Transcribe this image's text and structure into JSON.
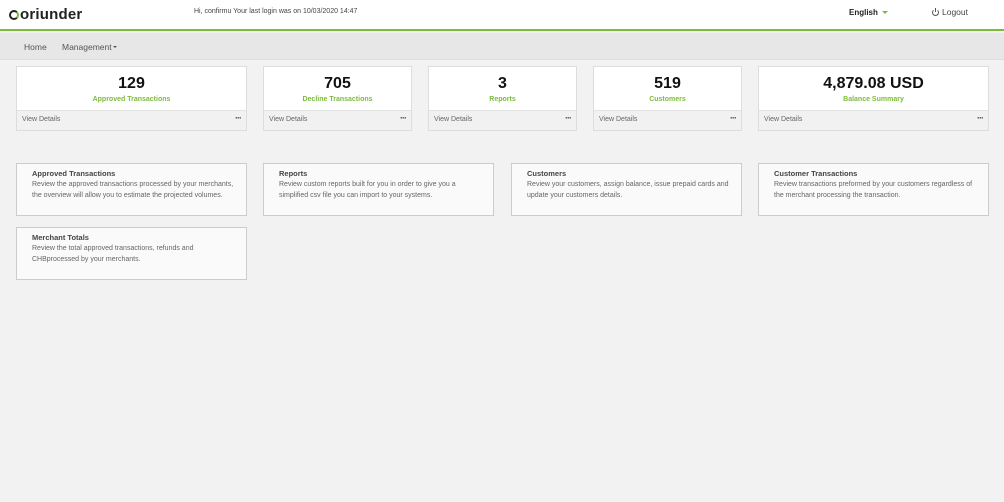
{
  "header": {
    "logo_text": "oriunder",
    "greeting": "Hi, confirmu Your last login was on 10/03/2020 14:47",
    "language": "English",
    "logout_label": "Logout"
  },
  "nav": {
    "home": "Home",
    "management": "Management"
  },
  "stats": [
    {
      "value": "129",
      "label": "Approved Transactions",
      "link": "View Details",
      "more": "···"
    },
    {
      "value": "705",
      "label": "Decline Transactions",
      "link": "View Details",
      "more": "···"
    },
    {
      "value": "3",
      "label": "Reports",
      "link": "View Details",
      "more": "···"
    },
    {
      "value": "519",
      "label": "Customers",
      "link": "View Details",
      "more": "···"
    },
    {
      "value": "4,879.08 USD",
      "label": "Balance Summary",
      "link": "View Details",
      "more": "···"
    }
  ],
  "cards": [
    {
      "title": "Approved Transactions",
      "desc": "Review the approved transactions processed by your merchants, the overview will allow you to estimate the projected volumes."
    },
    {
      "title": "Reports",
      "desc": "Review custom reports built for you in order to give you a simplified csv file you can import to your systems."
    },
    {
      "title": "Customers",
      "desc": "Review your customers, assign balance, issue prepaid cards and update your customers details."
    },
    {
      "title": "Customer Transactions",
      "desc": "Review transactions preformed by your customers regardless of the merchant processing the transaction."
    },
    {
      "title": "Merchant Totals",
      "desc": "Review the total approved transactions, refunds and CHBprocessed by your merchants."
    }
  ],
  "colors": {
    "accent": "#7dbb3c"
  }
}
